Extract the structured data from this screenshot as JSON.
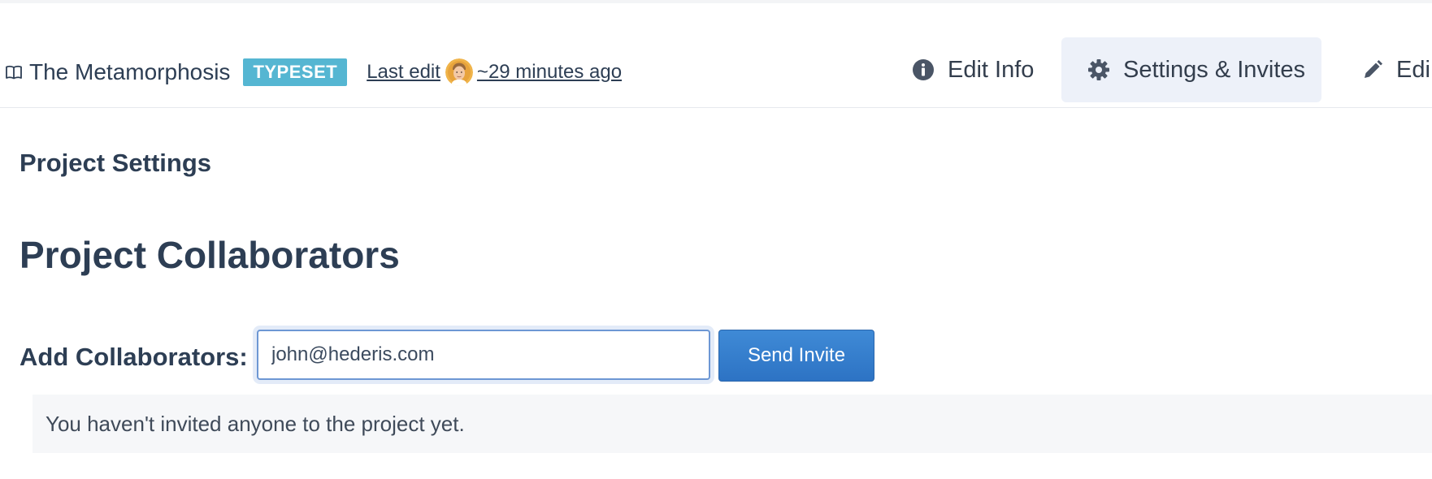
{
  "header": {
    "project_title": "The Metamorphosis",
    "badge": "TYPESET",
    "last_edit_label": "Last edit",
    "last_edit_ago": "~29 minutes ago",
    "nav": [
      {
        "label": "Edit Info",
        "icon": "info-icon"
      },
      {
        "label": "Settings & Invites",
        "icon": "gear-icon",
        "active": true
      },
      {
        "label": "Edi",
        "icon": "pencil-icon"
      }
    ]
  },
  "main": {
    "section_title": "Project Settings",
    "collaborators_title": "Project Collaborators",
    "add_label": "Add Collaborators:",
    "email_value": "john@hederis.com",
    "send_button": "Send Invite",
    "empty_notice": "You haven't invited anyone to the project yet."
  },
  "colors": {
    "badge_bg": "#55b6d2",
    "primary_button": "#2d73c4",
    "active_tab_bg": "#edf1f9",
    "text": "#2d3e54"
  }
}
